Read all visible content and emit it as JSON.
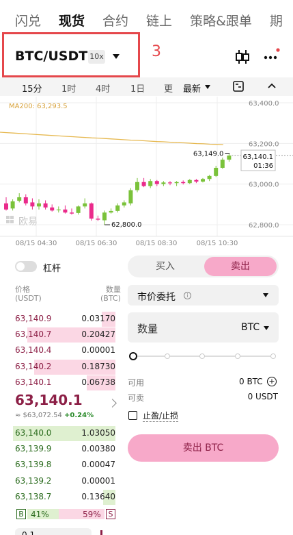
{
  "top_tabs": [
    "闪兑",
    "现货",
    "合约",
    "链上",
    "策略&跟单",
    "期"
  ],
  "active_top_tab": 1,
  "pair": {
    "name": "BTC/USDT",
    "leverage": "10x"
  },
  "annotation_number": "3",
  "toolbar": {
    "timeframes": [
      "15分",
      "1时",
      "4时",
      "1日",
      "更"
    ],
    "active_timeframe": 0,
    "latest_label": "最新"
  },
  "chart_data": {
    "type": "candlestick",
    "indicator_label": "MA200: 63,293.5",
    "y_ticks": [
      "63,400.0",
      "63,200.0",
      "63,000.0",
      "62,800.0"
    ],
    "ylim": [
      62770,
      63410
    ],
    "x_ticks": [
      "08/15 04:30",
      "08/15 06:30",
      "08/15 08:30",
      "08/15 10:30"
    ],
    "high_label": "63,149.0",
    "low_label": "62,800.0",
    "current_price_label": "63,140.1",
    "countdown_label": "01:36",
    "watermark": "欧易",
    "colors": {
      "up": "#7ac23a",
      "down": "#ea2a8b",
      "ma": "#e6b84f"
    },
    "candles": [
      [
        62905,
        62935,
        62870,
        62875
      ],
      [
        62880,
        62925,
        62870,
        62915
      ],
      [
        62918,
        62955,
        62910,
        62935
      ],
      [
        62935,
        62950,
        62895,
        62905
      ],
      [
        62910,
        62930,
        62875,
        62890
      ],
      [
        62890,
        62925,
        62875,
        62905
      ],
      [
        62905,
        62920,
        62875,
        62885
      ],
      [
        62885,
        62900,
        62865,
        62870
      ],
      [
        62872,
        62890,
        62860,
        62875
      ],
      [
        62875,
        62895,
        62855,
        62860
      ],
      [
        62860,
        62880,
        62850,
        62855
      ],
      [
        62858,
        62895,
        62850,
        62890
      ],
      [
        62890,
        62930,
        62880,
        62905
      ],
      [
        62905,
        62910,
        62820,
        62830
      ],
      [
        62830,
        62845,
        62818,
        62825
      ],
      [
        62822,
        62870,
        62800,
        62860
      ],
      [
        62860,
        62880,
        62855,
        62868
      ],
      [
        62868,
        62905,
        62860,
        62895
      ],
      [
        62895,
        62920,
        62885,
        62910
      ],
      [
        62905,
        62980,
        62895,
        62970
      ],
      [
        62970,
        63030,
        62960,
        63010
      ],
      [
        63010,
        63030,
        62985,
        62990
      ],
      [
        62990,
        63025,
        62980,
        63015
      ],
      [
        63015,
        63020,
        62990,
        63000
      ],
      [
        63000,
        63015,
        62990,
        63008
      ],
      [
        63008,
        63015,
        62995,
        63005
      ],
      [
        63005,
        63015,
        62990,
        63010
      ],
      [
        63010,
        63018,
        62998,
        63005
      ],
      [
        63005,
        63025,
        63000,
        63020
      ],
      [
        63020,
        63025,
        63005,
        63012
      ],
      [
        63012,
        63030,
        63008,
        63025
      ],
      [
        63025,
        63045,
        63015,
        63040
      ],
      [
        63040,
        63090,
        63035,
        63080
      ],
      [
        63080,
        63130,
        63075,
        63120
      ],
      [
        63120,
        63149,
        63110,
        63140.1
      ]
    ],
    "ma200": [
      63255,
      63253,
      63251,
      63249,
      63247,
      63245,
      63243,
      63241,
      63239,
      63237,
      63235,
      63233,
      63231,
      63229,
      63227,
      63226,
      63224,
      63222,
      63220,
      63218,
      63216,
      63215,
      63213,
      63211,
      63209,
      63208,
      63206,
      63204,
      63203,
      63201,
      63199,
      63198,
      63196,
      63195,
      63193
    ]
  },
  "leverage_toggle_label": "杠杆",
  "orderbook": {
    "price_header": "价格\n(USDT)",
    "qty_header": "数量\n(BTC)",
    "asks": [
      {
        "price": "63,140.9",
        "qty": "0.03170",
        "depth": 0.13
      },
      {
        "price": "63,140.7",
        "qty": "0.20427",
        "depth": 0.86
      },
      {
        "price": "63,140.4",
        "qty": "0.00001",
        "depth": 0.0
      },
      {
        "price": "63,140.2",
        "qty": "0.18730",
        "depth": 0.79
      },
      {
        "price": "63,140.1",
        "qty": "0.06738",
        "depth": 0.28
      }
    ],
    "last_price": "63,140.1",
    "last_sub": "≈ $63,072.54",
    "last_change": "+0.24%",
    "bids": [
      {
        "price": "63,140.0",
        "qty": "1.03050",
        "depth": 1.0
      },
      {
        "price": "63,139.9",
        "qty": "0.00380",
        "depth": 0.0
      },
      {
        "price": "63,139.8",
        "qty": "0.00047",
        "depth": 0.0
      },
      {
        "price": "63,139.2",
        "qty": "0.00001",
        "depth": 0.0
      },
      {
        "price": "63,138.7",
        "qty": "0.13640",
        "depth": 0.12
      }
    ],
    "buy_ratio_label": "B",
    "buy_ratio": "41%",
    "sell_ratio": "59%",
    "sell_ratio_label": "S",
    "buy_fraction": 0.41,
    "precision_value": "0.1"
  },
  "trade": {
    "buy_tab": "买入",
    "sell_tab": "卖出",
    "order_type": "市价委托",
    "qty_label": "数量",
    "qty_unit": "BTC",
    "slider_level": 0,
    "available_label": "可用",
    "available_value": "0 BTC",
    "sellable_label": "可卖",
    "sellable_value": "0 USDT",
    "tpsl_label": "止盈/止损",
    "submit_label": "卖出 BTC"
  }
}
